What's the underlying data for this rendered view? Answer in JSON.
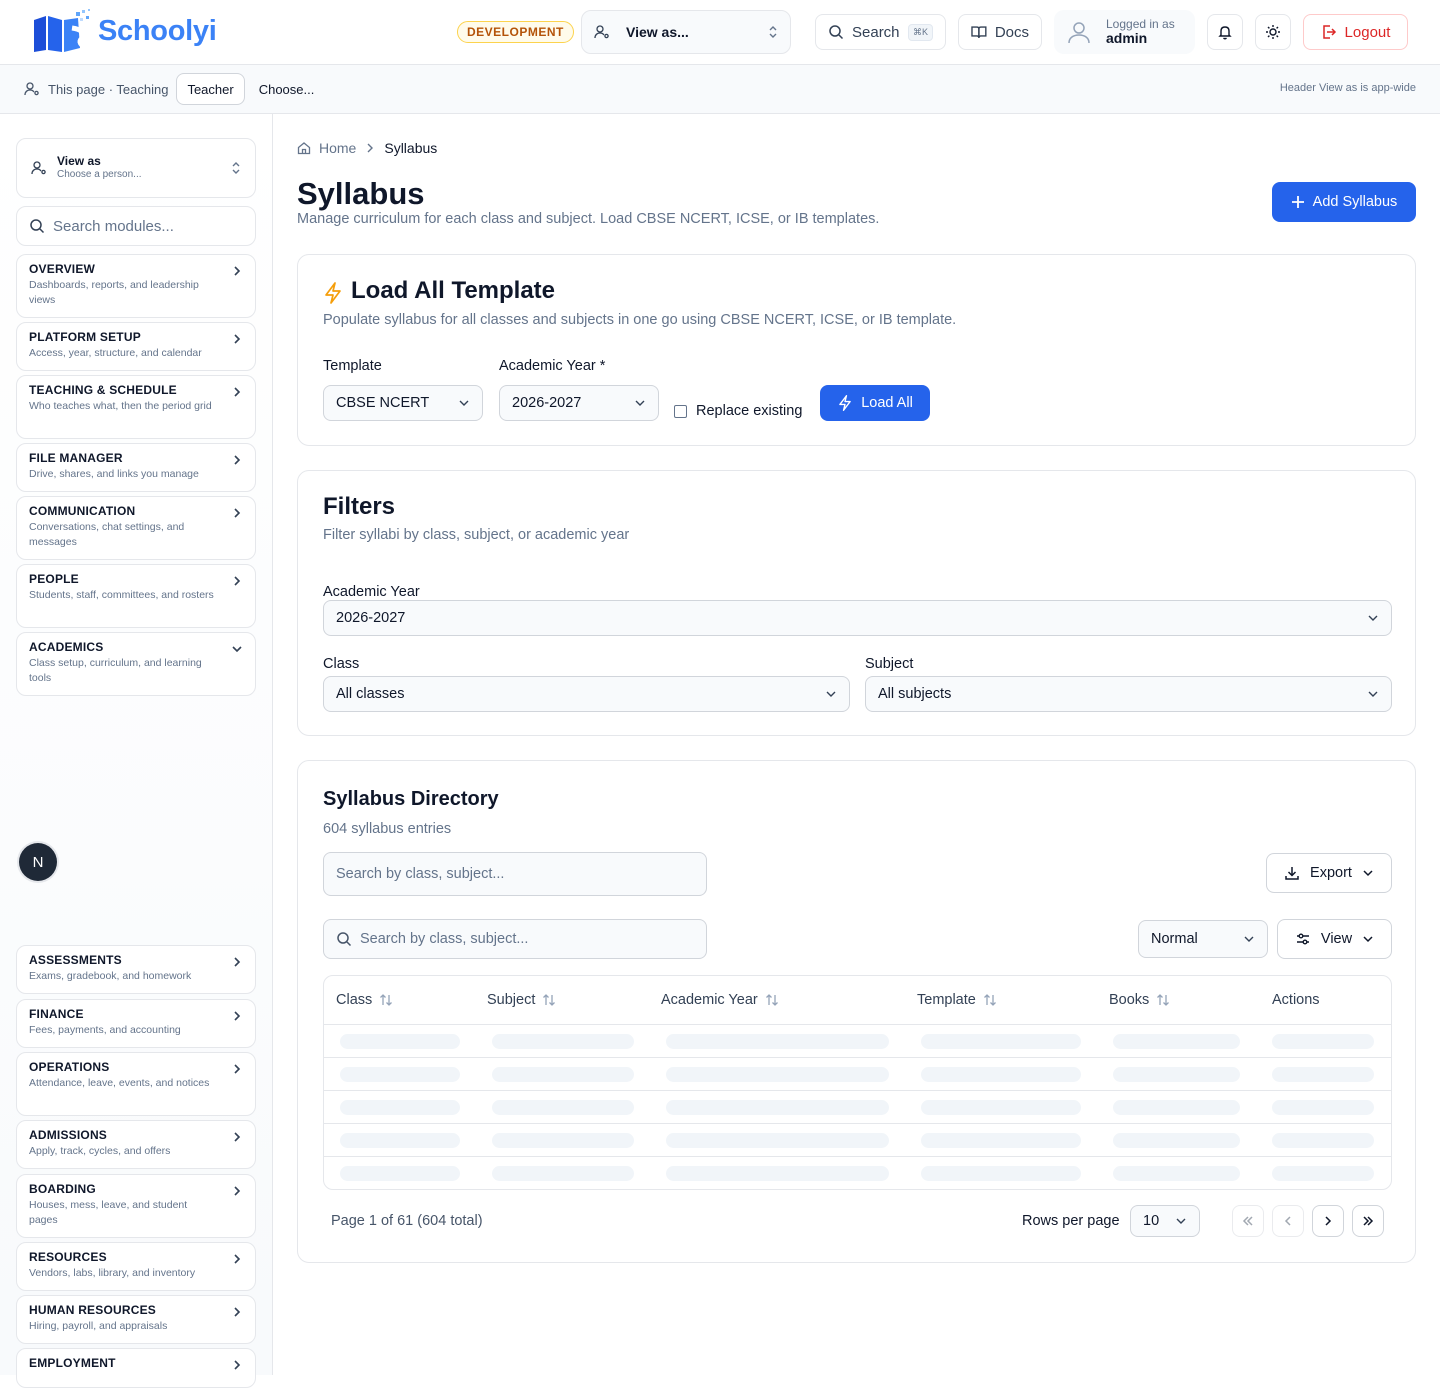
{
  "header": {
    "brand": "Schoolyi",
    "env_badge": "DEVELOPMENT",
    "view_as": "View as...",
    "search_label": "Search",
    "search_shortcut": "⌘K",
    "docs_label": "Docs",
    "logged_in_label": "Logged in as",
    "username": "admin",
    "logout_label": "Logout"
  },
  "subbar": {
    "context": "This page · Teaching",
    "role": "Teacher",
    "choose": "Choose...",
    "note": "Header View as is app-wide"
  },
  "sidebar": {
    "view_as_title": "View as",
    "view_as_sub": "Choose a person...",
    "search_placeholder": "Search modules...",
    "items": [
      {
        "title": "OVERVIEW",
        "desc": "Dashboards, reports, and leadership views"
      },
      {
        "title": "PLATFORM SETUP",
        "desc": "Access, year, structure, and calendar"
      },
      {
        "title": "TEACHING & SCHEDULE",
        "desc": "Who teaches what, then the period grid"
      },
      {
        "title": "FILE MANAGER",
        "desc": "Drive, shares, and links you manage"
      },
      {
        "title": "COMMUNICATION",
        "desc": "Conversations, chat settings, and messages"
      },
      {
        "title": "PEOPLE",
        "desc": "Students, staff, committees, and rosters"
      },
      {
        "title": "ACADEMICS",
        "desc": "Class setup, curriculum, and learning tools"
      },
      {
        "title": "ASSESSMENTS",
        "desc": "Exams, gradebook, and homework"
      },
      {
        "title": "FINANCE",
        "desc": "Fees, payments, and accounting"
      },
      {
        "title": "OPERATIONS",
        "desc": "Attendance, leave, events, and notices"
      },
      {
        "title": "ADMISSIONS",
        "desc": "Apply, track, cycles, and offers"
      },
      {
        "title": "BOARDING",
        "desc": "Houses, mess, leave, and student pages"
      },
      {
        "title": "RESOURCES",
        "desc": "Vendors, labs, library, and inventory"
      },
      {
        "title": "HUMAN RESOURCES",
        "desc": "Hiring, payroll, and appraisals"
      },
      {
        "title": "EMPLOYMENT",
        "desc": ""
      }
    ],
    "dev_badge": "N"
  },
  "breadcrumb": {
    "home": "Home",
    "current": "Syllabus"
  },
  "page": {
    "title": "Syllabus",
    "subtitle": "Manage curriculum for each class and subject. Load CBSE NCERT, ICSE, or IB templates.",
    "add_button": "Add Syllabus"
  },
  "load_template": {
    "title": "Load All Template",
    "subtitle": "Populate syllabus for all classes and subjects in one go using CBSE NCERT, ICSE, or IB template.",
    "template_label": "Template",
    "template_value": "CBSE NCERT",
    "year_label": "Academic Year *",
    "year_value": "2026-2027",
    "replace_label": "Replace existing",
    "load_button": "Load All"
  },
  "filters": {
    "title": "Filters",
    "subtitle": "Filter syllabi by class, subject, or academic year",
    "year_label": "Academic Year",
    "year_value": "2026-2027",
    "class_label": "Class",
    "class_value": "All classes",
    "subject_label": "Subject",
    "subject_value": "All subjects"
  },
  "directory": {
    "title": "Syllabus Directory",
    "count": "604 syllabus entries",
    "search_placeholder": "Search by class, subject...",
    "export_label": "Export",
    "search2_placeholder": "Search by class, subject...",
    "density": "Normal",
    "view_label": "View",
    "columns": [
      "Class",
      "Subject",
      "Academic Year",
      "Template",
      "Books",
      "Actions"
    ],
    "page_info": "Page 1 of 61 (604 total)",
    "rows_label": "Rows per page",
    "rows_value": "10"
  },
  "colors": {
    "primary": "#2563eb",
    "brand": "#3b82f6",
    "danger": "#dc2626",
    "accent_bolt": "#f59e0b"
  }
}
